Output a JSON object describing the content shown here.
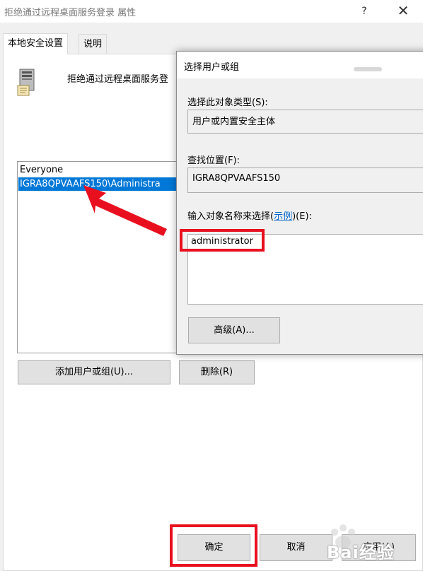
{
  "window": {
    "title": "拒绝通过远程桌面服务登录 属性",
    "help_glyph": "?",
    "close_glyph": "✕"
  },
  "tabs": [
    {
      "label": "本地安全设置",
      "selected": true
    },
    {
      "label": "说明",
      "selected": false
    }
  ],
  "policy": {
    "icon": "server-icon",
    "title": "拒绝通过远程桌面服务登"
  },
  "users_list": {
    "items": [
      {
        "label": "Everyone",
        "selected": false
      },
      {
        "label": "IGRA8QPVAAFS150\\Administra",
        "selected": true
      }
    ]
  },
  "buttons": {
    "add": "添加用户或组(U)...",
    "remove": "删除(R)",
    "ok": "确定",
    "cancel": "取消",
    "apply": "应用(A)"
  },
  "select_dialog": {
    "title": "选择用户或组",
    "object_type_label": "选择此对象类型(S):",
    "object_type_value": "用户或内置安全主体",
    "location_label": "查找位置(F):",
    "location_value": "IGRA8QPVAAFS150",
    "name_label_prefix": "输入对象名称来选择(",
    "name_label_link": "示例",
    "name_label_suffix": ")(E):",
    "name_value": "administrator",
    "advanced_button": "高级(A)..."
  },
  "annotations": {
    "highlight_color": "#e8101f",
    "selection_color": "#0078d7"
  },
  "watermark": {
    "text": "Bai经验"
  }
}
